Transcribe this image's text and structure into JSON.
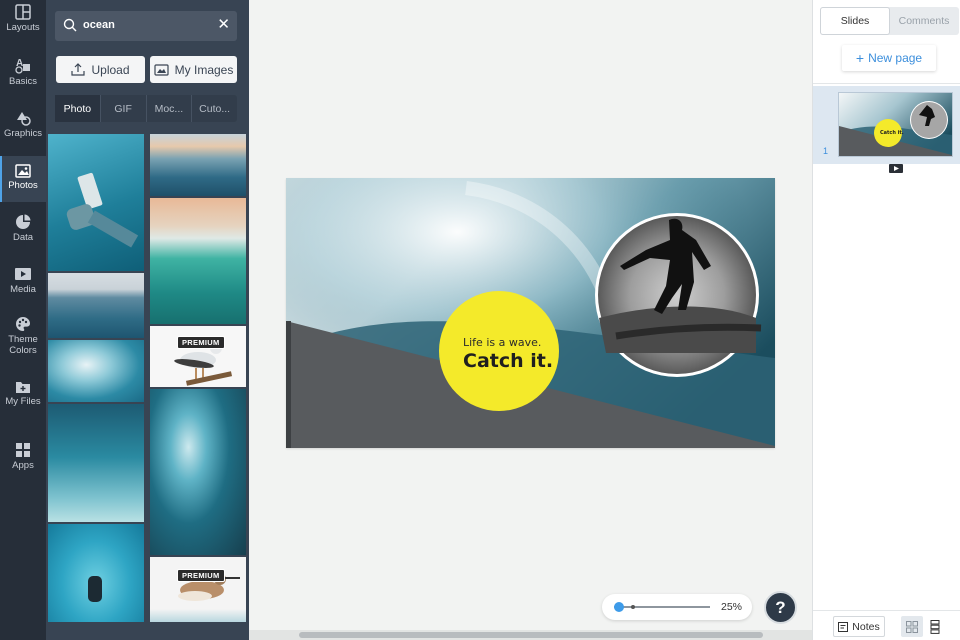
{
  "rail": {
    "items": [
      {
        "label": "Layouts",
        "icon": "layouts-icon"
      },
      {
        "label": "Basics",
        "icon": "basics-icon"
      },
      {
        "label": "Graphics",
        "icon": "graphics-icon"
      },
      {
        "label": "Photos",
        "icon": "photos-icon",
        "active": true
      },
      {
        "label": "Data",
        "icon": "data-icon"
      },
      {
        "label": "Media",
        "icon": "media-icon"
      },
      {
        "label": "Theme",
        "label2": "Colors",
        "icon": "palette-icon"
      },
      {
        "label": "My Files",
        "icon": "folder-icon"
      },
      {
        "label": "Apps",
        "icon": "apps-icon"
      }
    ]
  },
  "panel": {
    "search_value": "ocean",
    "upload_label": "Upload",
    "my_images_label": "My Images",
    "tabs": [
      "Photo",
      "GIF",
      "Moc...",
      "Cuto..."
    ],
    "premium_badge": "PREMIUM"
  },
  "slide": {
    "line1": "Life is a wave.",
    "line2": "Catch it.",
    "accent_color": "#f4ea2a"
  },
  "zoom": {
    "percent": "25%",
    "level": 0.05
  },
  "help": {
    "label": "?"
  },
  "sidebar": {
    "tab_slides": "Slides",
    "tab_comments": "Comments",
    "new_page": "New page",
    "slide_number": "1",
    "notes_label": "Notes"
  }
}
